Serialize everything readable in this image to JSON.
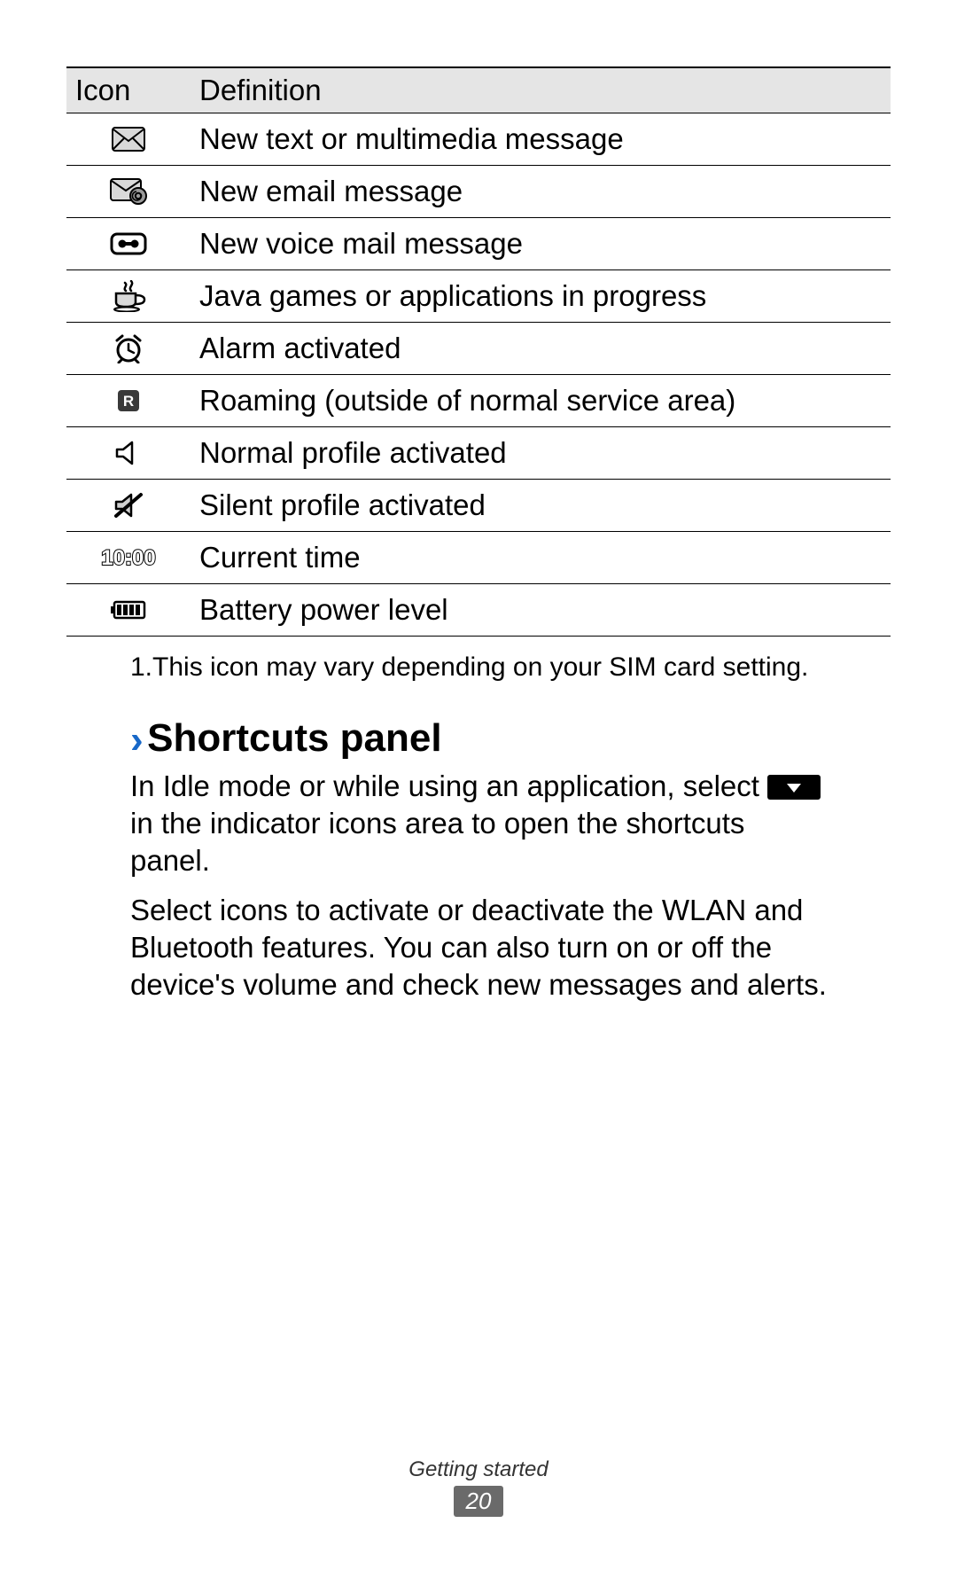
{
  "table": {
    "headers": {
      "icon": "Icon",
      "definition": "Definition"
    },
    "rows": [
      {
        "icon": "message-icon",
        "def": "New text or multimedia message"
      },
      {
        "icon": "email-icon",
        "def": "New email message"
      },
      {
        "icon": "voicemail-icon",
        "def": "New voice mail message"
      },
      {
        "icon": "java-icon",
        "def": "Java games or applications in progress"
      },
      {
        "icon": "alarm-icon",
        "def": "Alarm activated"
      },
      {
        "icon": "roaming-icon",
        "def": "Roaming (outside of normal service area)"
      },
      {
        "icon": "sound-icon",
        "def": "Normal profile activated"
      },
      {
        "icon": "silent-icon",
        "def": "Silent profile activated"
      },
      {
        "icon": "clock-icon",
        "def": "Current time",
        "time_text": "10:00"
      },
      {
        "icon": "battery-icon",
        "def": "Battery power level"
      }
    ]
  },
  "footnote": "1.This icon may vary depending on your SIM card setting.",
  "section": {
    "chevron": "›",
    "title": "Shortcuts panel",
    "para1_a": "In Idle mode or while using an application, select ",
    "para1_b": " in the indicator icons area to open the shortcuts panel.",
    "para2": "Select icons to activate or deactivate the WLAN and Bluetooth features. You can also turn on or off the device's volume and check new messages and alerts."
  },
  "footer": {
    "section": "Getting started",
    "page": "20"
  }
}
